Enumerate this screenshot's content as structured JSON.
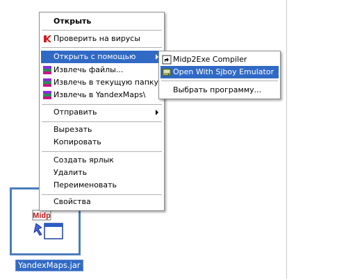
{
  "desktop": {
    "file_name": "YandexMaps.jar",
    "file_icon_text": "Midp",
    "file_icon": "jar-file-icon"
  },
  "context_menu": {
    "items": [
      {
        "label": "Открыть",
        "bold": true
      },
      {
        "label": "Проверить на вирусы",
        "icon": "kaspersky-icon"
      },
      {
        "label": "Открыть с помощью",
        "submenu": true,
        "selected": true
      },
      {
        "label": "Извлечь файлы...",
        "icon": "winrar-icon"
      },
      {
        "label": "Извлечь в текущую папку",
        "icon": "winrar-icon"
      },
      {
        "label": "Извлечь в YandexMaps\\",
        "icon": "winrar-icon"
      },
      {
        "label": "Отправить",
        "submenu": true
      },
      {
        "label": "Вырезать"
      },
      {
        "label": "Копировать"
      },
      {
        "label": "Создать ярлык"
      },
      {
        "label": "Удалить"
      },
      {
        "label": "Переименовать"
      },
      {
        "label": "Свойства"
      }
    ]
  },
  "open_with_submenu": {
    "items": [
      {
        "label": "Midp2Exe Compiler",
        "icon": "shortcut-icon"
      },
      {
        "label": "Open With Sjboy Emulator",
        "icon": "emulator-icon",
        "selected": true
      },
      {
        "label": "Выбрать программу..."
      }
    ]
  },
  "colors": {
    "selection": "#316ac5",
    "menu_border": "#8d8d8d",
    "tile_border": "#4a7dbc"
  }
}
